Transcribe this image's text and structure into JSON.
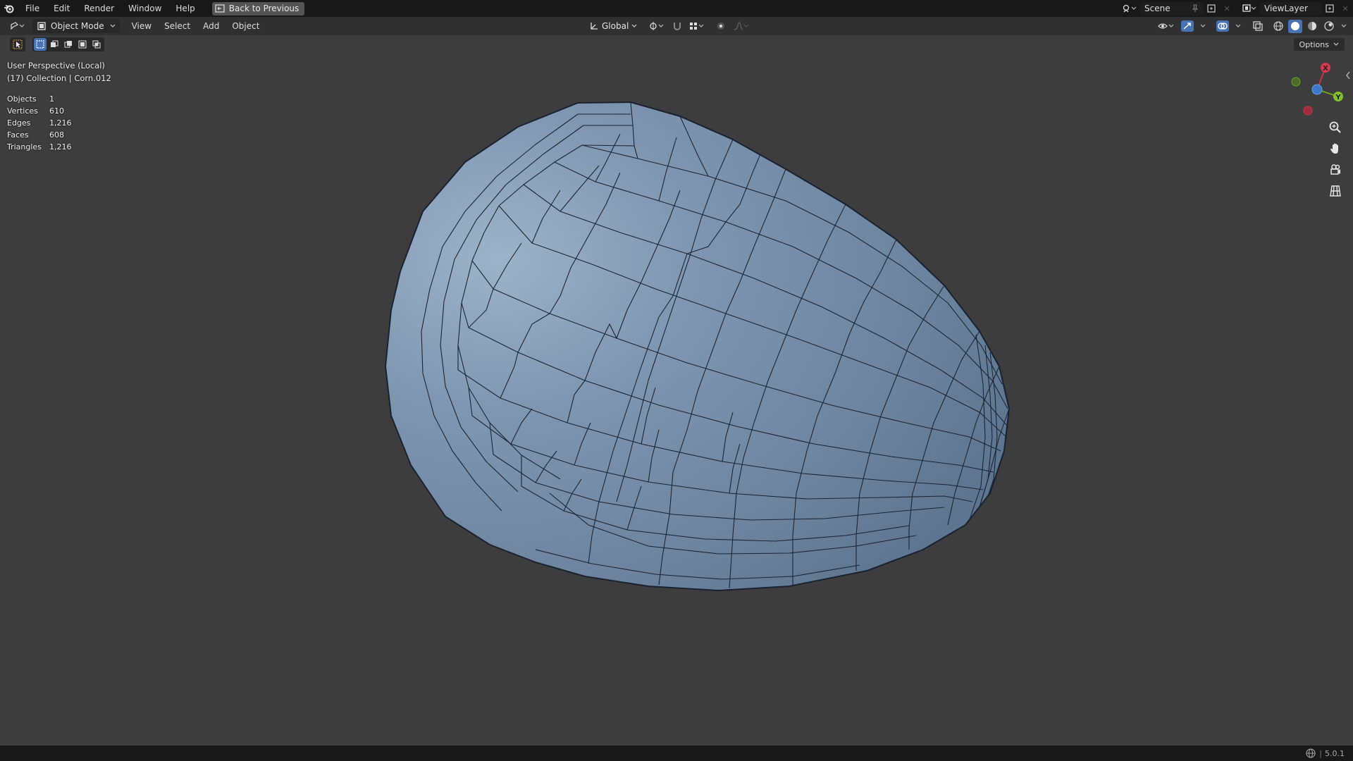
{
  "topbar": {
    "menu": [
      "File",
      "Edit",
      "Render",
      "Window",
      "Help"
    ],
    "back_label": "Back to Previous",
    "scene_label": "Scene",
    "view_layer_label": "ViewLayer"
  },
  "header": {
    "mode_label": "Object Mode",
    "menus": [
      "View",
      "Select",
      "Add",
      "Object"
    ],
    "transform_orientation": "Global"
  },
  "viewport": {
    "options_label": "Options",
    "perspective_label": "User Perspective (Local)",
    "collection_label": "(17) Collection | Corn.012",
    "stats": [
      {
        "label": "Objects",
        "value": "1"
      },
      {
        "label": "Vertices",
        "value": "610"
      },
      {
        "label": "Edges",
        "value": "1,216"
      },
      {
        "label": "Faces",
        "value": "608"
      },
      {
        "label": "Triangles",
        "value": "1,216"
      }
    ],
    "gizmo": {
      "x": "X",
      "y": "Y"
    },
    "mesh_color": "#7189a3"
  },
  "statusbar": {
    "version": "5.0.1"
  }
}
